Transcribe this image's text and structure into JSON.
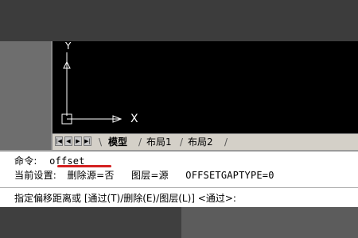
{
  "viewport": {
    "ucs_y_label": "Y",
    "ucs_x_label": "X"
  },
  "tabs": {
    "items": [
      {
        "label": "模型",
        "active": true
      },
      {
        "label": "布局1",
        "active": false
      },
      {
        "label": "布局2",
        "active": false
      }
    ],
    "nav_icons": [
      "first-tab-icon",
      "prev-tab-icon",
      "next-tab-icon",
      "last-tab-icon"
    ]
  },
  "command": {
    "line1_prefix": "命令:",
    "line1_command": "offset",
    "line2_label": "当前设置:",
    "line2_setting1": "删除源=否",
    "line2_setting2": "图层=源",
    "line2_setting3": "OFFSETGAPTYPE=0",
    "prompt": "指定偏移距离或 [通过(T)/删除(E)/图层(L)] <通过>:"
  },
  "colors": {
    "viewport_bg": "#000000",
    "command_bg": "#ffffff",
    "underline": "#d42020"
  }
}
